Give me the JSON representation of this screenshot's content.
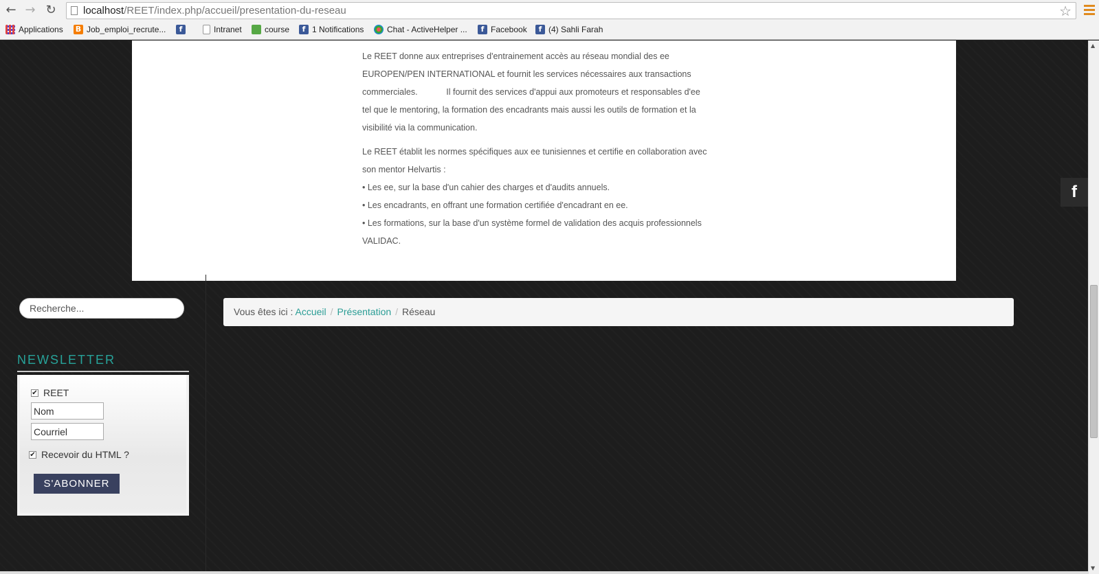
{
  "browser": {
    "url_host": "localhost",
    "url_path": "/REET/index.php/accueil/presentation-du-reseau",
    "bookmarks": [
      {
        "label": "Applications",
        "icon": "apps-grid-icon"
      },
      {
        "label": "Job_emploi_recrute...",
        "icon": "blogger-icon"
      },
      {
        "label": "",
        "icon": "facebook-icon"
      },
      {
        "label": "Intranet",
        "icon": "page-icon"
      },
      {
        "label": "course",
        "icon": "green-icon"
      },
      {
        "label": "1 Notifications",
        "icon": "facebook-icon"
      },
      {
        "label": "Chat - ActiveHelper ...",
        "icon": "chat-icon"
      },
      {
        "label": "Facebook",
        "icon": "facebook-icon"
      },
      {
        "label": "(4) Sahli Farah",
        "icon": "facebook-icon"
      }
    ]
  },
  "article": {
    "p1_lines": [
      "Le REET donne aux entreprises d'entrainement accès au réseau mondial des ee",
      "EUROPEN/PEN INTERNATIONAL et fournit les services nécessaires aux transactions",
      "commerciales.            Il fournit des services d'appui aux promoteurs et responsables d'ee",
      "tel que le mentoring, la formation des encadrants mais aussi les outils de formation et la",
      "visibilité via la communication."
    ],
    "p2_lines": [
      "Le REET établit les normes spécifiques aux ee tunisiennes et certifie en collaboration avec",
      "son mentor Helvartis :",
      "• Les ee, sur la base d'un cahier des charges et d'audits annuels.",
      "• Les encadrants, en offrant une formation certifiée d'encadrant en ee.",
      "• Les formations, sur la base d'un système formel de validation des acquis professionnels",
      "VALIDAC."
    ]
  },
  "search": {
    "placeholder": "Recherche..."
  },
  "breadcrumb": {
    "prefix": "Vous êtes ici : ",
    "items": [
      "Accueil",
      "Présentation",
      "Réseau"
    ]
  },
  "newsletter": {
    "title": "NEWSLETTER",
    "list_label": "REET",
    "name_placeholder": "Nom",
    "email_placeholder": "Courriel",
    "html_label": "Recevoir du HTML ?",
    "submit_label": "S'ABONNER"
  },
  "social": {
    "facebook_glyph": "f"
  },
  "colors": {
    "accent": "#27a39a",
    "button": "#39415f"
  }
}
